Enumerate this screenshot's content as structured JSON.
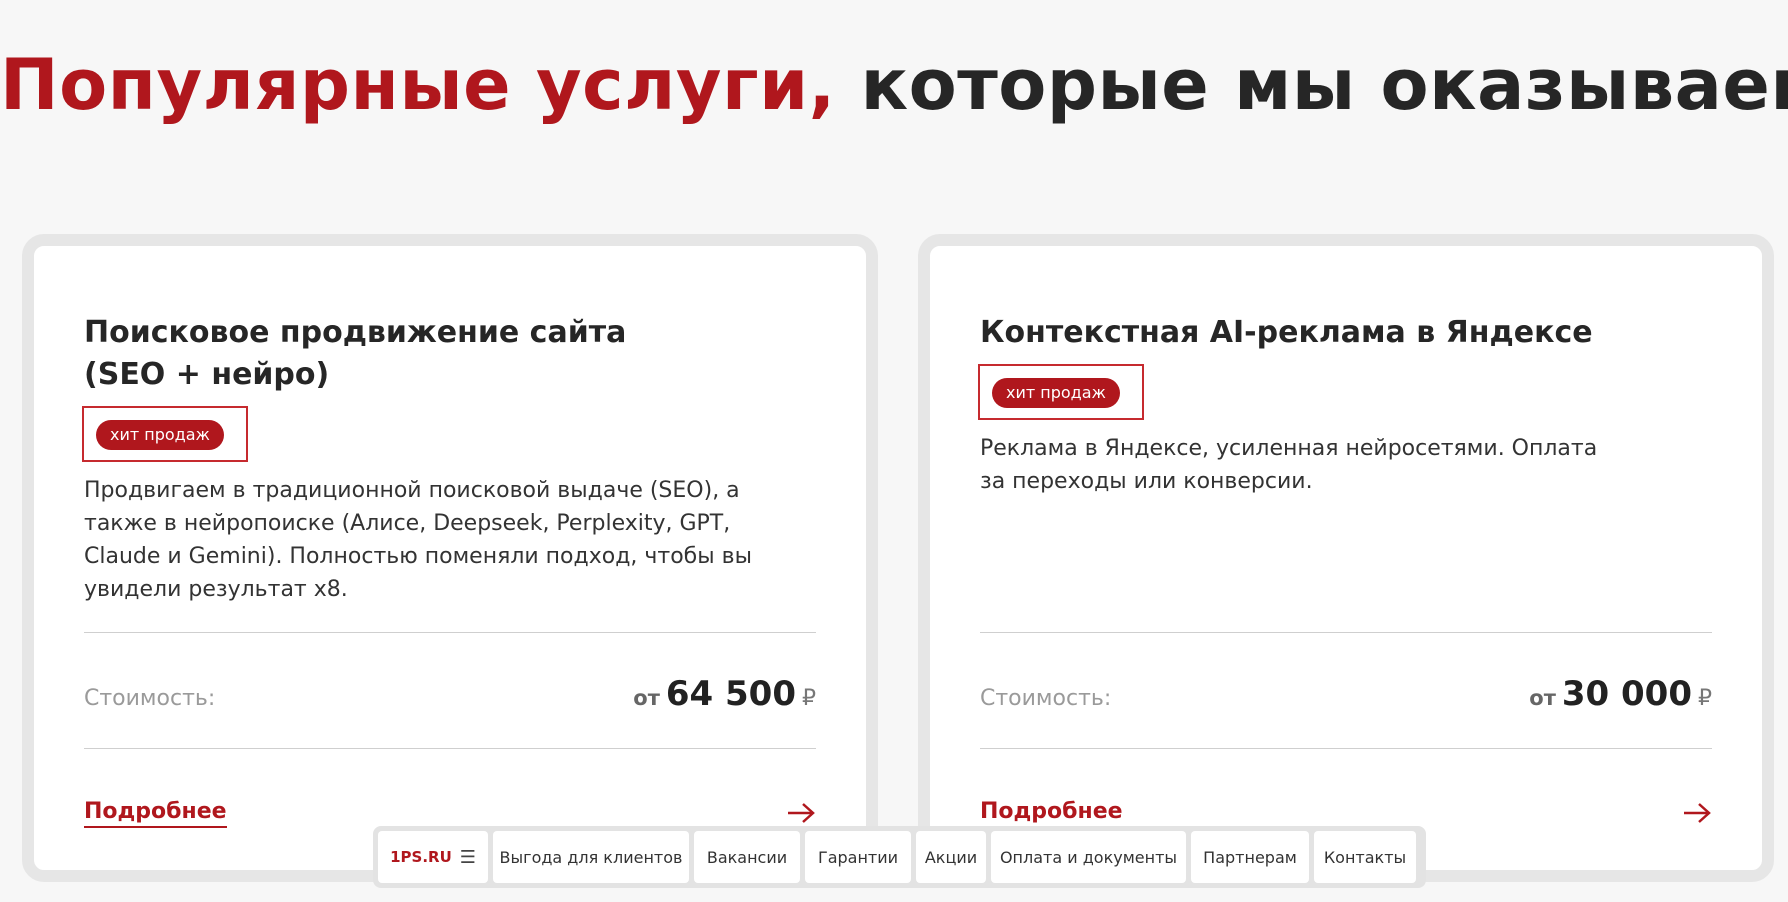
{
  "heading": {
    "accent": "Популярные услуги,",
    "rest": " которые мы оказываем"
  },
  "cards": [
    {
      "title": "Поисковое продвижение сайта (SEO + нейро)",
      "badge": "хит продаж",
      "description": "Продвигаем в традиционной поисковой выдаче (SEO), а также в нейропоиске (Алисе, Deepseek, Perplexity, GPT, Claude и Gemini). Полностью поменяли подход, чтобы вы увидели результат x8.",
      "cost_label": "Стоимость:",
      "price_from": "от",
      "price": "64 500",
      "currency": "₽",
      "more_label": "Подробнее",
      "icon": "arrow-right-icon"
    },
    {
      "title": "Контекстная AI-реклама в Яндексе",
      "badge": "хит продаж",
      "description": "Реклама в Яндексе, усиленная нейросетями. Оплата за переходы или конверсии.",
      "cost_label": "Стоимость:",
      "price_from": "от",
      "price": "30 000",
      "currency": "₽",
      "more_label": "Подробнее",
      "icon": "arrow-right-icon"
    }
  ],
  "navbar": {
    "logo": "1PS.RU",
    "menu_icon": "burger-menu-icon",
    "items": [
      "Выгода для клиентов",
      "Вакансии",
      "Гарантии",
      "Акции",
      "Оплата и документы",
      "Партнерам",
      "Контакты"
    ]
  },
  "colors": {
    "accent": "#b0171d",
    "text": "#262626",
    "muted": "#9a9a9a",
    "background": "#f7f7f7"
  }
}
